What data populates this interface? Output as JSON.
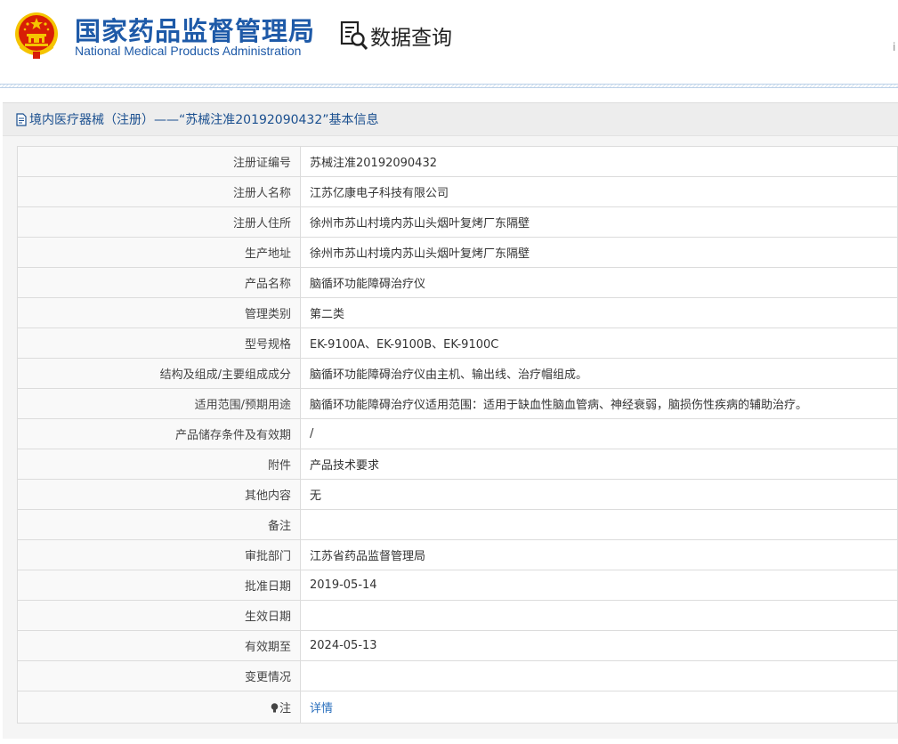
{
  "header": {
    "org_name_cn": "国家药品监督管理局",
    "org_name_en": "National Medical Products Administration",
    "query_label": "数据查询",
    "right_glyph": "i",
    "emblem_icon": "national-emblem-icon",
    "query_icon": "magnifier-document-icon"
  },
  "panel": {
    "title": "境内医疗器械（注册）——“苏械注准20192090432”基本信息",
    "title_icon": "document-icon"
  },
  "rows": [
    {
      "label": "注册证编号",
      "value": "苏械注准20192090432"
    },
    {
      "label": "注册人名称",
      "value": "江苏亿康电子科技有限公司"
    },
    {
      "label": "注册人住所",
      "value": "徐州市苏山村境内苏山头烟叶复烤厂东隔壁"
    },
    {
      "label": "生产地址",
      "value": "徐州市苏山村境内苏山头烟叶复烤厂东隔壁"
    },
    {
      "label": "产品名称",
      "value": "脑循环功能障碍治疗仪"
    },
    {
      "label": "管理类别",
      "value": "第二类"
    },
    {
      "label": "型号规格",
      "value": "EK-9100A、EK-9100B、EK-9100C"
    },
    {
      "label": "结构及组成/主要组成成分",
      "value": "脑循环功能障碍治疗仪由主机、输出线、治疗帽组成。"
    },
    {
      "label": "适用范围/预期用途",
      "value": "脑循环功能障碍治疗仪适用范围：适用于缺血性脑血管病、神经衰弱，脑损伤性疾病的辅助治疗。"
    },
    {
      "label": "产品储存条件及有效期",
      "value": "/"
    },
    {
      "label": "附件",
      "value": "产品技术要求"
    },
    {
      "label": "其他内容",
      "value": "无"
    },
    {
      "label": "备注",
      "value": ""
    },
    {
      "label": "审批部门",
      "value": "江苏省药品监督管理局"
    },
    {
      "label": "批准日期",
      "value": "2019-05-14"
    },
    {
      "label": "生效日期",
      "value": ""
    },
    {
      "label": "有效期至",
      "value": "2024-05-13"
    },
    {
      "label": "变更情况",
      "value": ""
    }
  ],
  "note_row": {
    "label": "注",
    "value": "详情",
    "icon": "lightbulb-icon"
  },
  "colors": {
    "brand_blue": "#1e5aa8",
    "title_blue": "#1a4f8f",
    "link_blue": "#2a6fbd",
    "emblem_red": "#d81e06",
    "emblem_gold": "#f5c400"
  }
}
